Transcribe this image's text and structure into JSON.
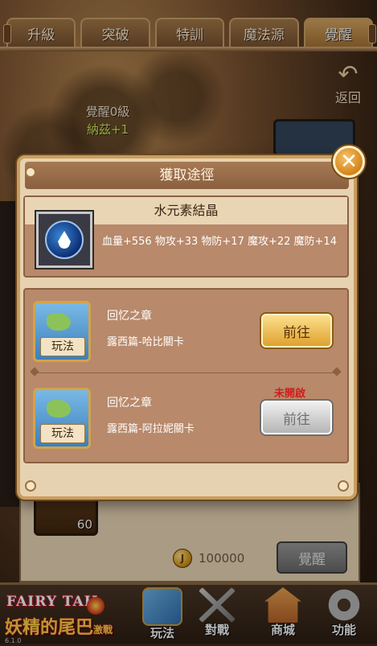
{
  "tabs": [
    {
      "label": "升級"
    },
    {
      "label": "突破"
    },
    {
      "label": "特訓"
    },
    {
      "label": "魔法源"
    },
    {
      "label": "覺醒"
    }
  ],
  "back": {
    "label": "返回"
  },
  "awaken": {
    "level": "覺醒0級",
    "bonus": "納茲+1"
  },
  "card": {
    "level": "60"
  },
  "currency": {
    "icon": "coin-icon",
    "symbol": "J",
    "amount": "100000"
  },
  "awaken_button": {
    "label": "覺醒"
  },
  "modal": {
    "title": "獲取途徑",
    "close_symbol": "✕",
    "item": {
      "name": "水元素結晶",
      "icon": "water-drop-icon",
      "stats": "血量+556 物攻+33 物防+17 魔攻+22 魔防+14"
    },
    "routes": [
      {
        "icon_label": "玩法",
        "title": "回忆之章",
        "subtitle": "露西篇-哈比關卡",
        "button": "前往",
        "enabled": true,
        "status": ""
      },
      {
        "icon_label": "玩法",
        "title": "回忆之章",
        "subtitle": "露西篇-阿拉妮關卡",
        "button": "前往",
        "enabled": false,
        "status": "未開啟"
      }
    ]
  },
  "logo": {
    "top": "FAIRY TAIL",
    "cn": "妖精的尾巴",
    "suffix": "激戰",
    "version": "6.1.0"
  },
  "bottom_nav": [
    {
      "label": "玩法",
      "icon": "map-icon"
    },
    {
      "label": "對戰",
      "icon": "crossed-swords-icon"
    },
    {
      "label": "商城",
      "icon": "shop-icon"
    },
    {
      "label": "功能",
      "icon": "gear-icon"
    }
  ],
  "colors": {
    "gold_button": "#e0a12f",
    "locked_text": "#d11c1c",
    "bonus_text": "#c9f05a"
  }
}
